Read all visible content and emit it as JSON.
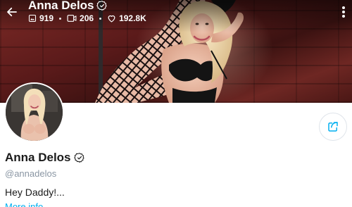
{
  "cover": {
    "display_name": "Anna Delos",
    "verified": true,
    "stats": {
      "photos": "919",
      "videos": "206",
      "likes": "192.8K"
    },
    "icons": {
      "back": "arrow-left-icon",
      "photos": "image-icon",
      "videos": "video-icon",
      "likes": "heart-icon",
      "more": "more-vertical-icon"
    }
  },
  "profile": {
    "display_name": "Anna Delos",
    "username": "@annadelos",
    "bio": "Hey Daddy!...",
    "more_info_label": "More info",
    "share_icon": "share-icon"
  },
  "colors": {
    "accent": "#00aff0",
    "muted_text": "#8a96a3",
    "border": "#dfe4ea"
  }
}
